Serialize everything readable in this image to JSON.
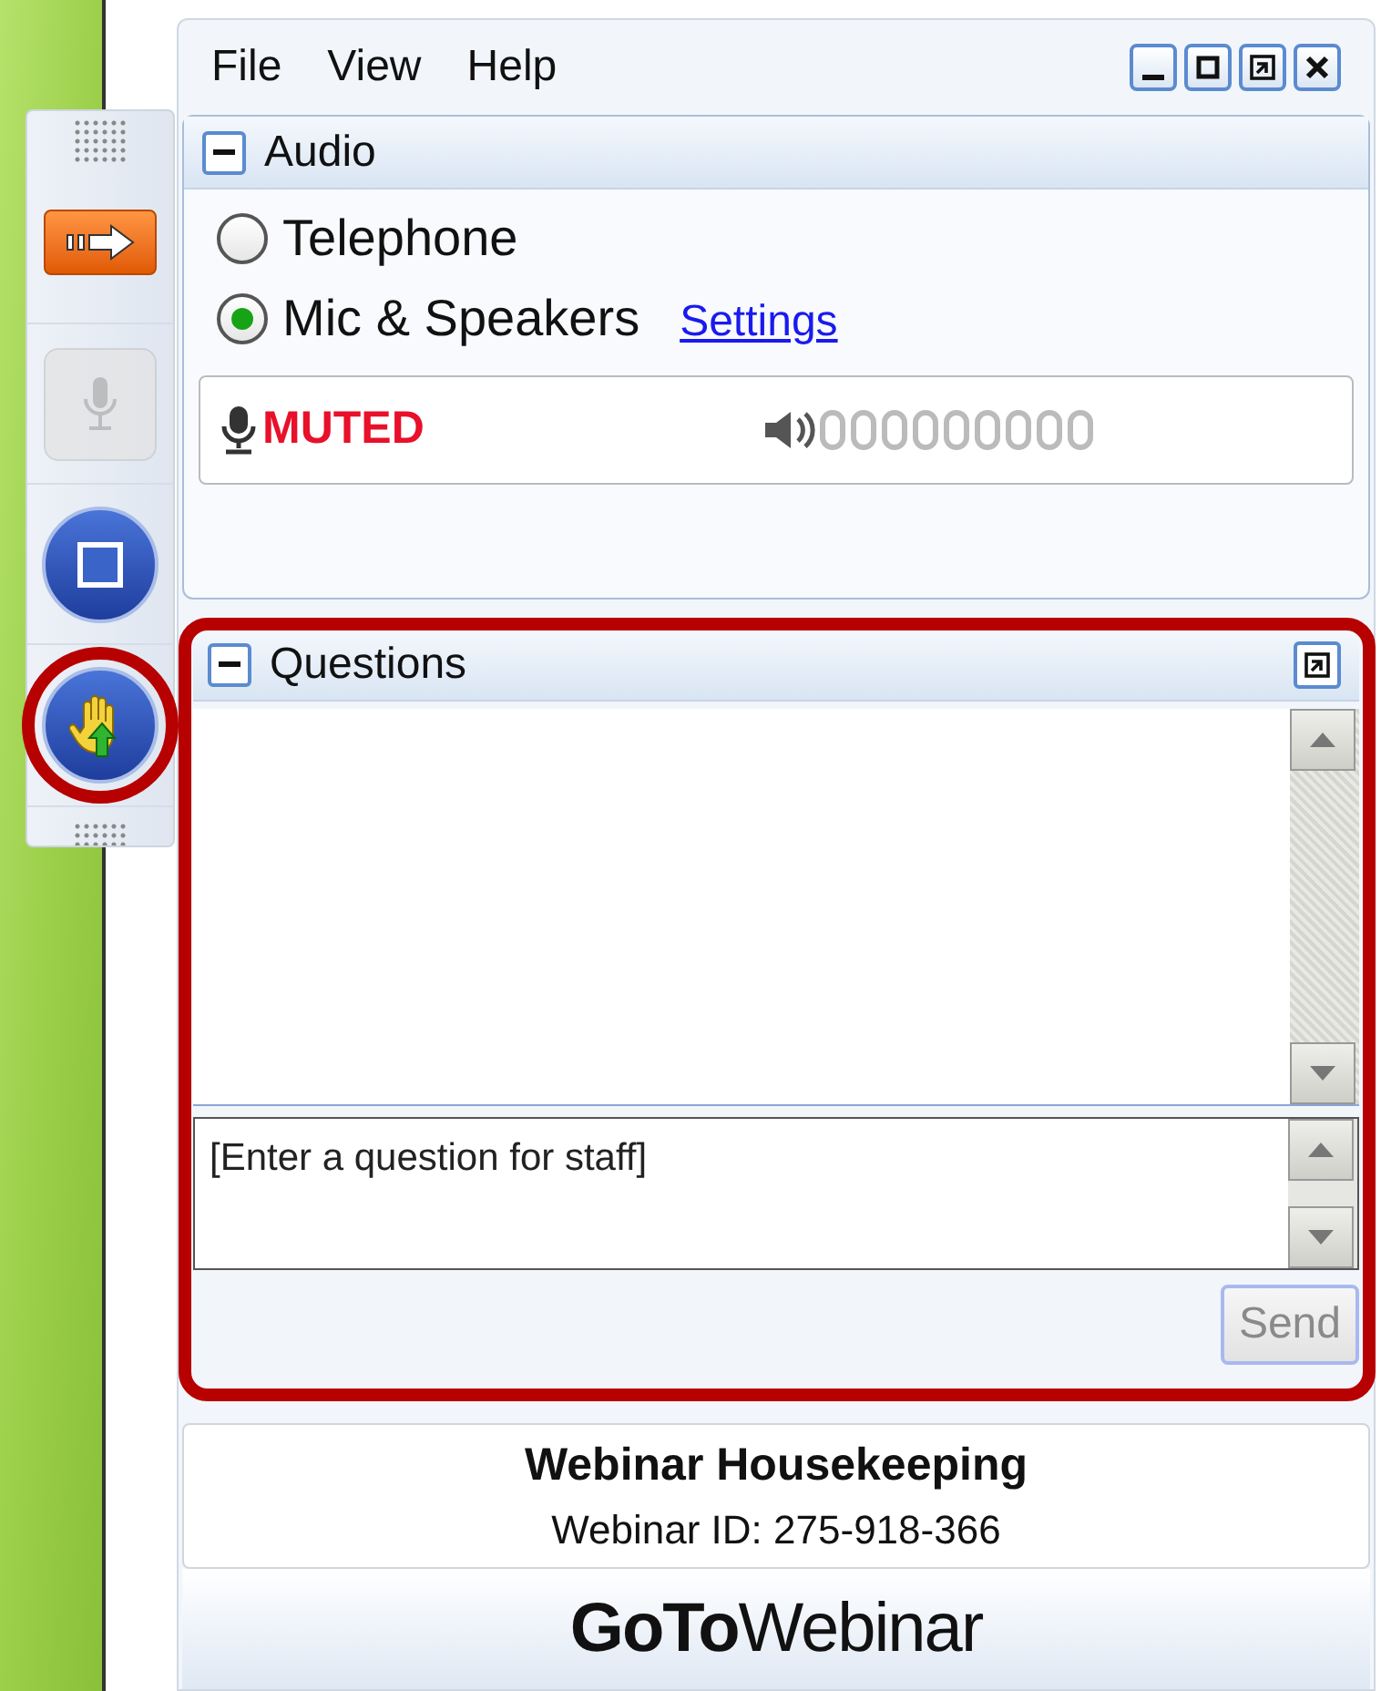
{
  "menu": [
    {
      "label": "File"
    },
    {
      "label": "View"
    },
    {
      "label": "Help"
    }
  ],
  "window_controls": [
    {
      "kind": "minimize"
    },
    {
      "kind": "maximize"
    },
    {
      "kind": "restore"
    },
    {
      "kind": "close"
    }
  ],
  "toolbar": [
    {
      "kind": "arrow",
      "disabled": false,
      "highlighted": false
    },
    {
      "kind": "mic",
      "disabled": true,
      "highlighted": false
    },
    {
      "kind": "screen",
      "disabled": false,
      "highlighted": false
    },
    {
      "kind": "hand",
      "disabled": false,
      "highlighted": true
    }
  ],
  "audio": {
    "title": "Audio",
    "expanded": true,
    "options": [
      {
        "label": "Telephone",
        "selected": false
      },
      {
        "label": "Mic & Speakers",
        "selected": true
      }
    ],
    "settings_link": "Settings",
    "mic_status": "MUTED",
    "speaker": {
      "level": 0
    }
  },
  "questions": {
    "title": "Questions",
    "expanded": true,
    "highlighted": true,
    "input": {
      "placeholder": "[Enter a question for staff]"
    },
    "send_button": {
      "label": "Send",
      "disabled": true
    }
  },
  "footer": {
    "title": "Webinar Housekeeping",
    "webinar_id": "Webinar ID: 275-918-366",
    "logo": "**GoTo**Webinar"
  }
}
